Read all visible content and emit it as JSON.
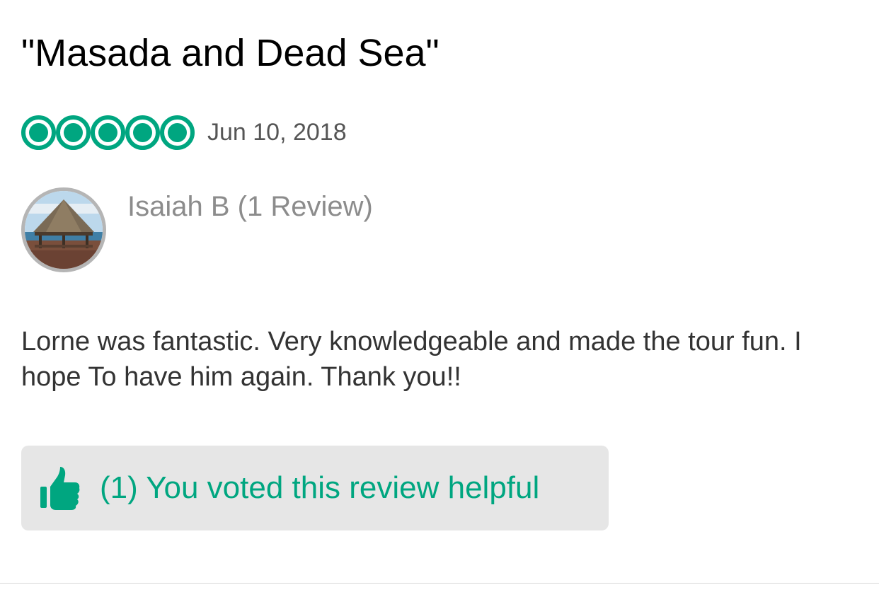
{
  "review": {
    "title": "\"Masada and Dead Sea\"",
    "rating": 5,
    "rating_max": 5,
    "date": "Jun 10, 2018",
    "reviewer": "Isaiah B (1 Review)",
    "avatar_icon": "beach-gazebo-photo",
    "body": "Lorne was fantastic. Very knowledgeable and made the tour fun. I hope To have him again. Thank you!!"
  },
  "helpful": {
    "label": "(1) You voted this review helpful",
    "icon": "thumbs-up-icon"
  },
  "colors": {
    "accent": "#00a680",
    "button_bg": "#e6e6e6",
    "text": "#333333",
    "muted": "#8c8c8c"
  }
}
